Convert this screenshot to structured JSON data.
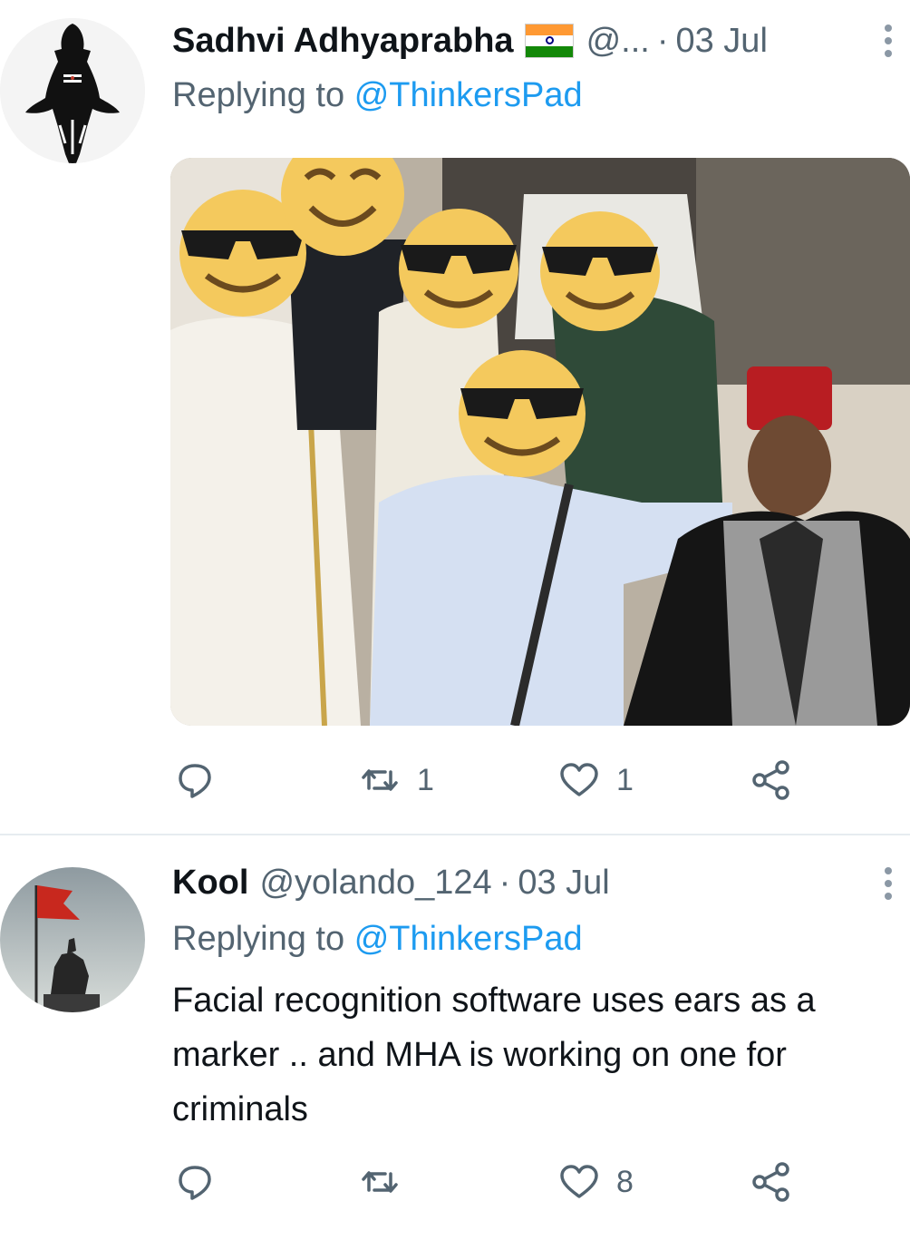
{
  "tweets": [
    {
      "author_name": "Sadhvi Adhyaprabha",
      "handle": "@...",
      "separator": "·",
      "date": "03 Jul",
      "replying_label": "Replying to",
      "replying_to": "@ThinkersPad",
      "text": "",
      "has_flag": true,
      "has_media": true,
      "actions": {
        "replies": "",
        "retweets": "1",
        "likes": "1"
      }
    },
    {
      "author_name": "Kool",
      "handle": "@yolando_124",
      "separator": "·",
      "date": "03 Jul",
      "replying_label": "Replying to",
      "replying_to": "@ThinkersPad",
      "text": "Facial recognition software uses ears as a marker .. and MHA is working on one for criminals",
      "has_flag": false,
      "has_media": false,
      "actions": {
        "replies": "",
        "retweets": "",
        "likes": "8"
      }
    }
  ],
  "icons": {
    "reply": "speech-bubble-icon",
    "retweet": "retweet-arrows-icon",
    "like": "heart-icon",
    "share": "share-nodes-icon",
    "more": "vertical-ellipsis-icon"
  },
  "colors": {
    "text_primary": "#0f1419",
    "text_secondary": "#536471",
    "link": "#1d9bf0",
    "divider": "#e6ecf0",
    "emoji_face": "#f4c95d"
  }
}
